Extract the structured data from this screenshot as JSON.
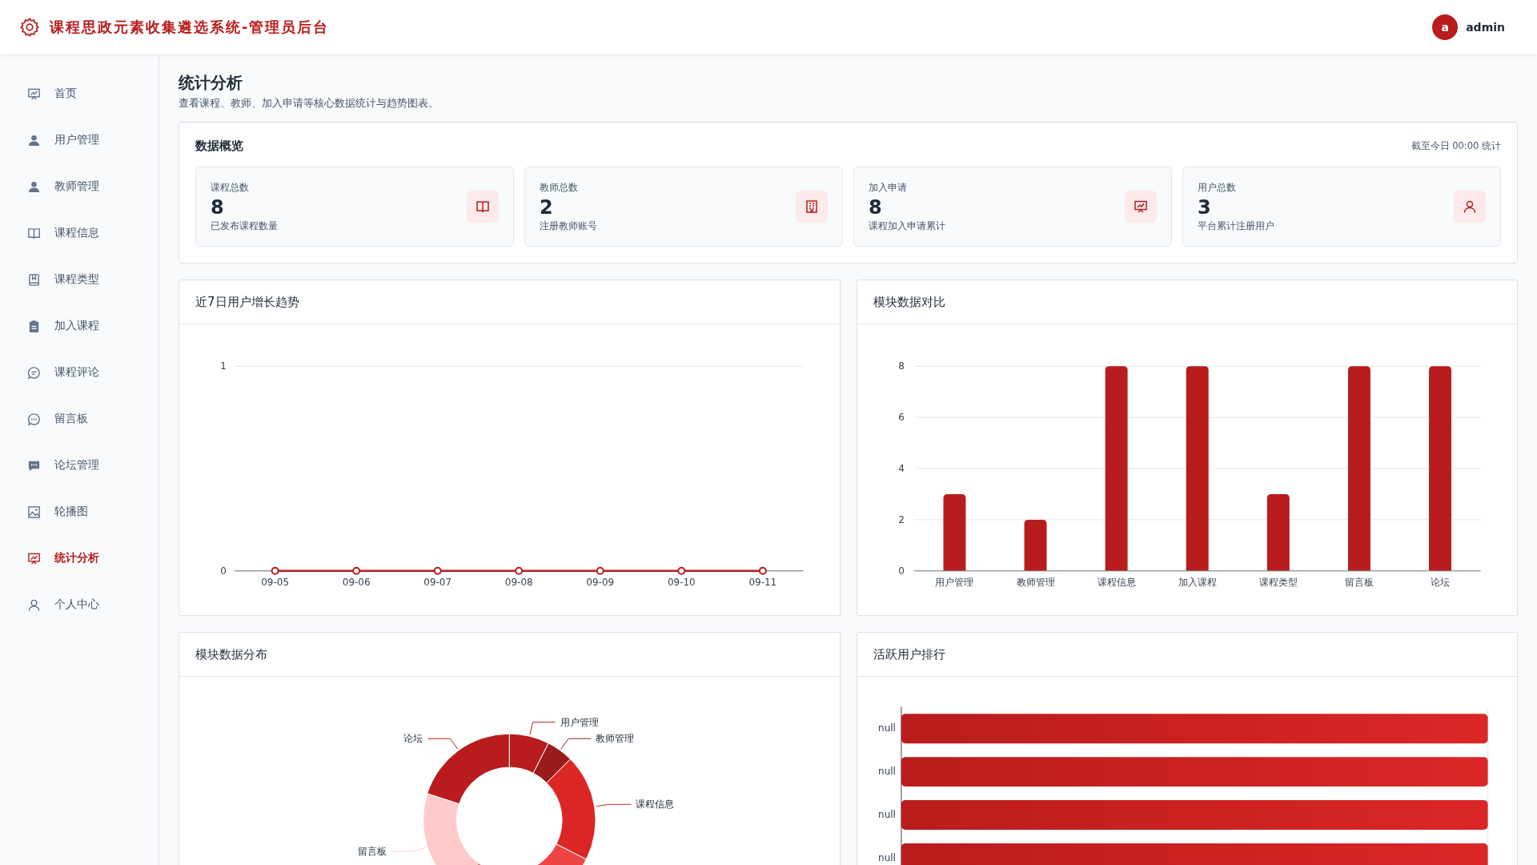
{
  "header": {
    "title": "课程思政元素收集遴选系统-管理员后台",
    "user": {
      "initial": "a",
      "name": "admin"
    }
  },
  "sidebar": {
    "items": [
      {
        "label": "首页",
        "selected": false
      },
      {
        "label": "用户管理",
        "selected": false
      },
      {
        "label": "教师管理",
        "selected": false
      },
      {
        "label": "课程信息",
        "selected": false
      },
      {
        "label": "课程类型",
        "selected": false
      },
      {
        "label": "加入课程",
        "selected": false
      },
      {
        "label": "课程评论",
        "selected": false
      },
      {
        "label": "留言板",
        "selected": false
      },
      {
        "label": "论坛管理",
        "selected": false
      },
      {
        "label": "轮播图",
        "selected": false
      },
      {
        "label": "统计分析",
        "selected": true
      },
      {
        "label": "个人中心",
        "selected": false
      }
    ]
  },
  "page": {
    "title": "统计分析",
    "subtitle": "查看课程、教师、加入申请等核心数据统计与趋势图表。"
  },
  "overview": {
    "title": "数据概览",
    "note": "截至今日 00:00 统计",
    "cards": [
      {
        "label": "课程总数",
        "value": "8",
        "caption": "已发布课程数量"
      },
      {
        "label": "教师总数",
        "value": "2",
        "caption": "注册教师账号"
      },
      {
        "label": "加入申请",
        "value": "8",
        "caption": "课程加入申请累计"
      },
      {
        "label": "用户总数",
        "value": "3",
        "caption": "平台累计注册用户"
      }
    ]
  },
  "trend": {
    "title": "近7日用户增长趋势",
    "chart_data": {
      "type": "line",
      "categories": [
        "09-05",
        "09-06",
        "09-07",
        "09-08",
        "09-09",
        "09-10",
        "09-11"
      ],
      "color": "#b91c1c",
      "values": [
        0,
        0,
        0,
        0,
        0,
        0,
        0
      ],
      "marker": true,
      "ylim": [
        0,
        1
      ],
      "yticks": [
        0,
        1
      ]
    }
  },
  "compare": {
    "title": "模块数据对比",
    "chart_data": {
      "type": "bar",
      "categories": [
        "用户管理",
        "教师管理",
        "课程信息",
        "加入课程",
        "课程类型",
        "留言板",
        "论坛"
      ],
      "color": "#b91c1c",
      "values": [
        3,
        2,
        8,
        8,
        3,
        8,
        8
      ],
      "grid": true,
      "ylim": [
        0,
        8
      ],
      "yticks": [
        0,
        2,
        4,
        6,
        8
      ]
    }
  },
  "distribution": {
    "title": "模块数据分布",
    "chart_data": {
      "type": "donut",
      "categories": [
        "用户管理",
        "教师管理",
        "课程信息",
        null,
        null,
        "留言板",
        "论坛"
      ],
      "values": [
        7.5,
        5,
        20,
        20,
        7.5,
        20,
        20
      ],
      "colors": [
        "#b91c1c",
        "#991b1b",
        "#dc2626",
        "#ef4444",
        "#f87171",
        "#fecaca",
        "#b91c1c"
      ]
    }
  },
  "ranking": {
    "title": "活跃用户排行",
    "rows": [
      {
        "label": "null",
        "level": 1
      },
      {
        "label": "null",
        "level": 1
      },
      {
        "label": "null",
        "level": 1
      },
      {
        "label": "null",
        "level": 1
      }
    ]
  }
}
